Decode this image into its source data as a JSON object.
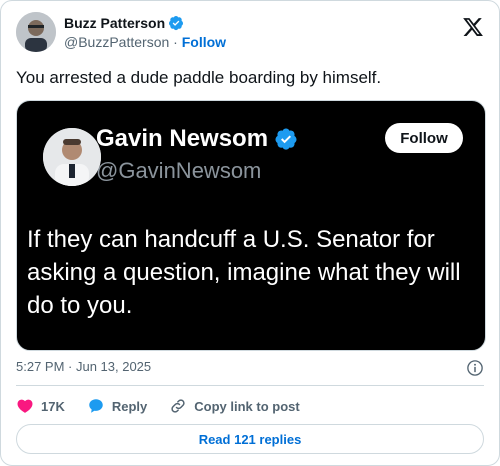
{
  "author": {
    "name": "Buzz Patterson",
    "handle": "@BuzzPatterson",
    "separator": "·",
    "follow_label": "Follow"
  },
  "tweet": {
    "text": "You arrested a dude paddle boarding by himself."
  },
  "embedded_post": {
    "name": "Gavin Newsom",
    "handle": "@GavinNewsom",
    "follow_label": "Follow",
    "text": "If they can handcuff a U.S. Senator for asking a question, imagine what they will do to you."
  },
  "meta": {
    "timestamp": "5:27 PM · Jun 13, 2025"
  },
  "actions": {
    "like_count": "17K",
    "reply_label": "Reply",
    "copy_link_label": "Copy link to post"
  },
  "footer": {
    "read_replies_label": "Read 121 replies"
  },
  "colors": {
    "link_blue": "#006fd6",
    "verified_blue": "#1d9bf0",
    "heart_red": "#f91880",
    "muted": "#536471"
  }
}
